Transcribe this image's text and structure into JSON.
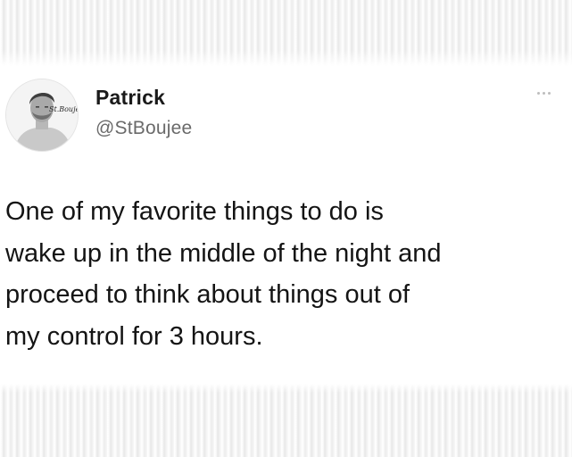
{
  "tweet": {
    "author": {
      "display_name": "Patrick",
      "handle": "@StBoujee",
      "avatar_watermark": "St.Boujee"
    },
    "more_icon": "more-horizontal-icon",
    "body": "One of my favorite things to do is\nwake up in the middle of the night and\nproceed to think about things out of\nmy control for 3 hours."
  }
}
